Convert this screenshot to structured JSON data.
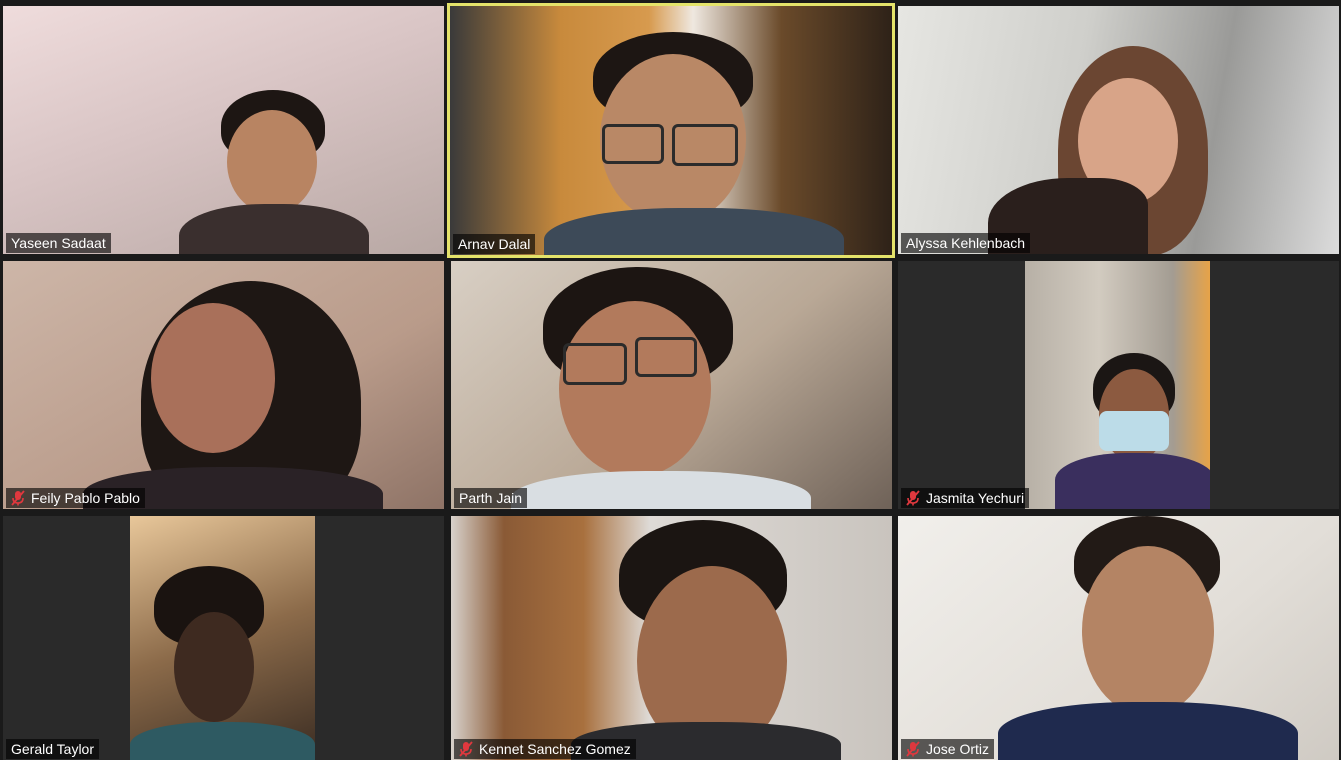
{
  "participants": [
    {
      "name": "Yaseen Sadaat",
      "muted": false,
      "active": false
    },
    {
      "name": "Arnav Dalal",
      "muted": false,
      "active": true
    },
    {
      "name": "Alyssa Kehlenbach",
      "muted": false,
      "active": false
    },
    {
      "name": "Feily Pablo Pablo",
      "muted": true,
      "active": false
    },
    {
      "name": "Parth Jain",
      "muted": false,
      "active": false
    },
    {
      "name": "Jasmita Yechuri",
      "muted": true,
      "active": false
    },
    {
      "name": "Gerald Taylor",
      "muted": false,
      "active": false
    },
    {
      "name": "Kennet Sanchez Gomez",
      "muted": true,
      "active": false
    },
    {
      "name": "Jose Ortiz",
      "muted": true,
      "active": false
    }
  ],
  "colors": {
    "background": "#1a1a1a",
    "tile_background": "#2a2a2a",
    "active_speaker_border": "#e4e36a",
    "mute_icon": "#e0383e"
  },
  "icons": {
    "muted": "microphone-muted-icon"
  }
}
